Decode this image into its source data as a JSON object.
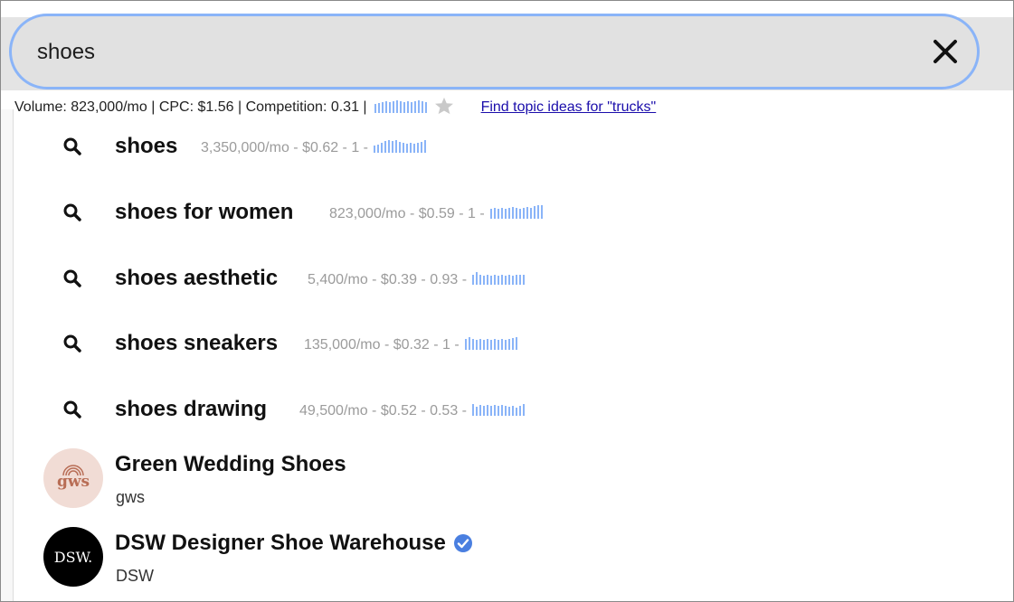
{
  "search": {
    "value": "shoes",
    "clear_icon": "close-icon",
    "focus_color": "#8ab4f8"
  },
  "keyword_info": {
    "text": "Volume: 823,000/mo | CPC: $1.56 | Competition: 0.31 |",
    "spark_color": "#8ab4f8",
    "favorite_icon": "star-icon",
    "topic_link": "Find topic ideas for \"trucks\""
  },
  "suggestions": [
    {
      "term": "shoes",
      "meta": "3,350,000/mo - $0.62 - 1 -"
    },
    {
      "term": "shoes for women",
      "meta": "823,000/mo - $0.59 - 1 -"
    },
    {
      "term": "shoes aesthetic",
      "meta": "5,400/mo - $0.39 - 0.93 -"
    },
    {
      "term": "shoes sneakers",
      "meta": "135,000/mo - $0.32 - 1 -"
    },
    {
      "term": "shoes drawing",
      "meta": "49,500/mo - $0.52 - 0.53 -"
    }
  ],
  "entities": [
    {
      "name": "Green Wedding Shoes",
      "sub": "gws",
      "logo_text": "gws",
      "verified": false
    },
    {
      "name": "DSW Designer Shoe Warehouse",
      "sub": "DSW",
      "logo_text": "DSW.",
      "verified": true
    }
  ],
  "colors": {
    "link": "#1a0dab",
    "meta_text": "#9b9b9b",
    "verified_badge": "#4a7fe0"
  }
}
